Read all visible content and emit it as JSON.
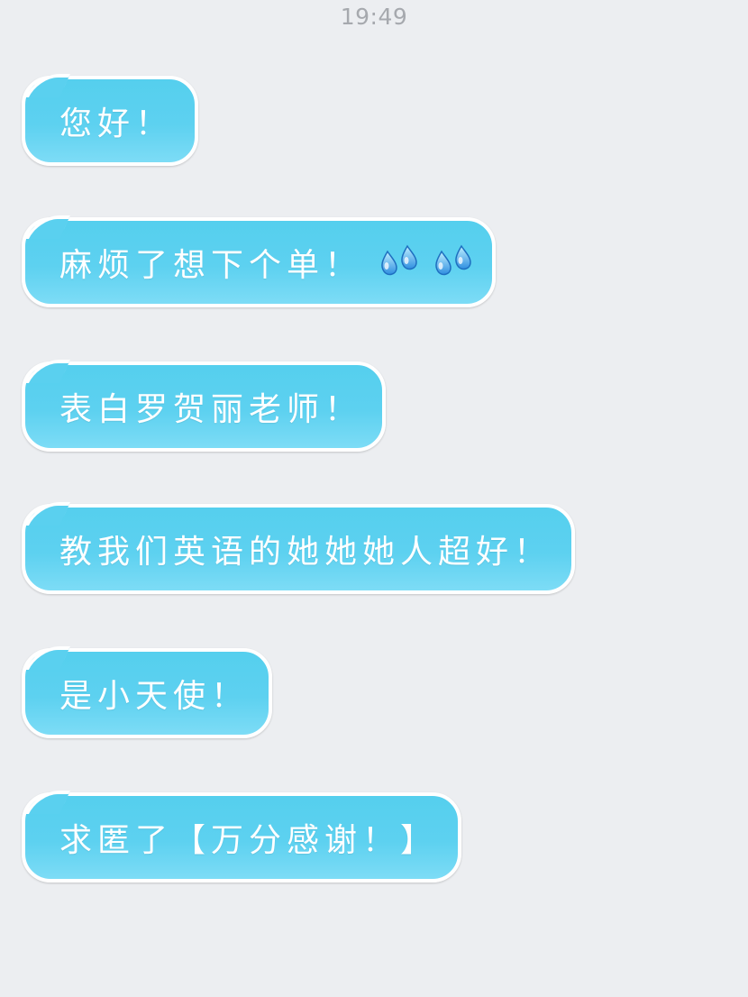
{
  "status": {
    "time": "19:49"
  },
  "messages": [
    {
      "text": "您好！"
    },
    {
      "text": "麻烦了想下个单！",
      "emoji": "sweat-drops-icon"
    },
    {
      "text": "表白罗贺丽老师！"
    },
    {
      "text": "教我们英语的她她她人超好！"
    },
    {
      "text": "是小天使！"
    },
    {
      "text": "求匿了【万分感谢！】"
    }
  ],
  "colors": {
    "background": "#eceef1",
    "bubble": "#5ad0ef",
    "bubble_border": "#ffffff",
    "timestamp": "#a6a9ae"
  }
}
